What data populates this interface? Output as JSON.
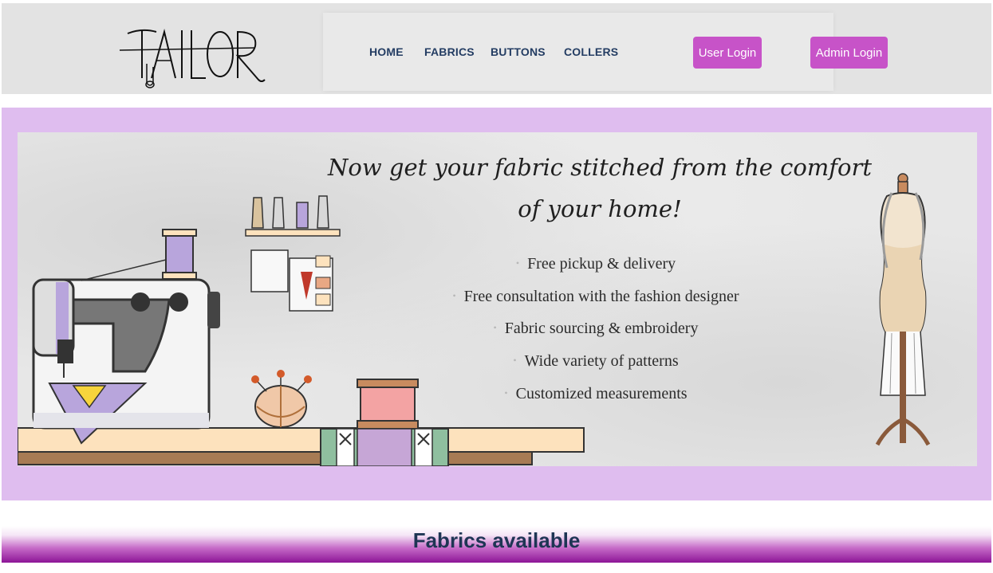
{
  "brand": {
    "logo_text": "TAILOR"
  },
  "nav": {
    "items": [
      "HOME",
      "FABRICS",
      "BUTTONS",
      "COLLERS"
    ]
  },
  "auth": {
    "user_login": "User Login",
    "admin_login": "Admin Login"
  },
  "hero": {
    "headline_line1": "Now get your fabric stitched from the comfort",
    "headline_line2": "of your home!",
    "features": [
      "Free pickup & delivery",
      "Free consultation with the fashion designer",
      "Fabric sourcing & embroidery",
      "Wide variety of patterns",
      "Customized measurements"
    ]
  },
  "section": {
    "title": "Fabrics available"
  },
  "colors": {
    "accent": "#c753c8",
    "nav_text": "#243d63",
    "hero_frame": "#dfbdef",
    "section_gradient_end": "#8c1596"
  }
}
